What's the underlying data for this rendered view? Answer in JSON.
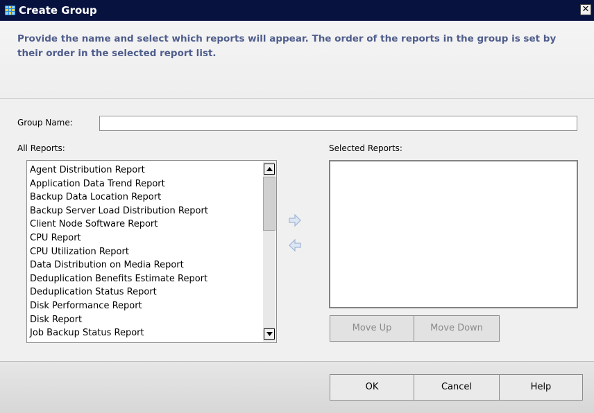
{
  "window": {
    "title": "Create Group",
    "close_label": "✕"
  },
  "instructions": "Provide the name and select which reports will appear.  The order of the reports in the group is set by their order in the selected report list.",
  "group_name": {
    "label": "Group Name:",
    "value": ""
  },
  "all_reports": {
    "label": "All Reports:",
    "items": [
      "Agent Distribution Report",
      "Application Data Trend Report",
      "Backup Data Location Report",
      "Backup Server Load Distribution Report",
      "Client Node Software Report",
      "CPU Report",
      "CPU Utilization Report",
      "Data Distribution on Media Report",
      "Deduplication Benefits Estimate Report",
      "Deduplication Status Report",
      "Disk Performance Report",
      "Disk Report",
      "Job Backup Status Report"
    ]
  },
  "selected_reports": {
    "label": "Selected Reports:",
    "items": []
  },
  "buttons": {
    "move_up": "Move Up",
    "move_down": "Move Down",
    "ok": "OK",
    "cancel": "Cancel",
    "help": "Help"
  },
  "icons": {
    "title": "grid-app-icon",
    "add": "right-arrow-icon",
    "remove": "left-arrow-icon",
    "scroll_up": "scroll-up-icon",
    "scroll_down": "scroll-down-icon"
  },
  "colors": {
    "titlebar": "#07123f",
    "instruction_text": "#4f5d8c",
    "arrow": "#9fb6d6"
  }
}
